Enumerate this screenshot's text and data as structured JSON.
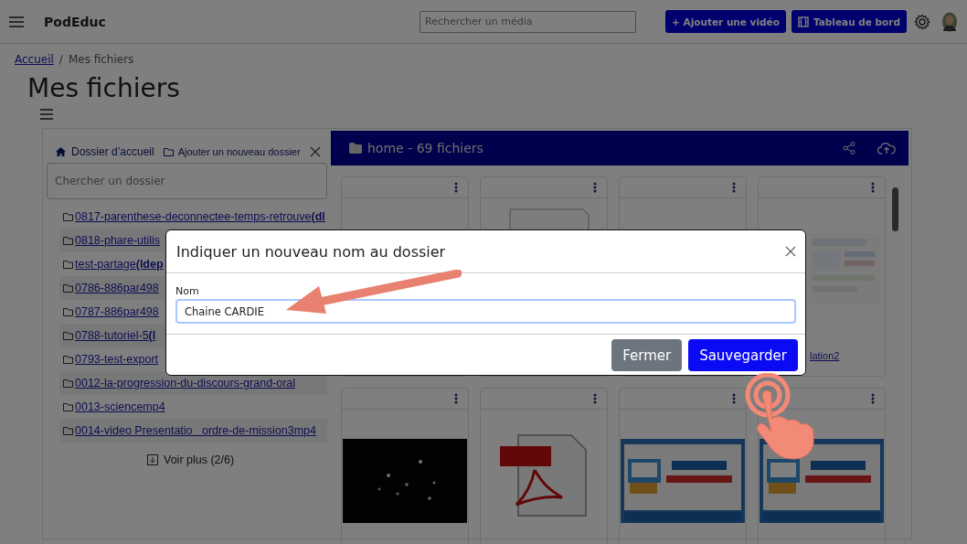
{
  "header": {
    "brand": "PodEduc",
    "search_placeholder": "Rechercher un média",
    "buttons": [
      {
        "label": "+ Ajouter une vidéo",
        "kind": "plain"
      },
      {
        "label": "Tableau de bord",
        "kind": "film"
      }
    ]
  },
  "breadcrumb": [
    {
      "label": "Accueil",
      "link": true
    },
    {
      "separator": "/",
      "label": "Mes fichiers",
      "link": false
    }
  ],
  "title": "Mes fichiers",
  "sidebar": {
    "home_label": "Dossier d’accueil",
    "add_label": "Ajouter un nouveau dossier",
    "search_placeholder": "Chercher un dossier",
    "folders": [
      {
        "name": "0817-parenthese-deconnectee-temps-retrouve**(dl**"
      },
      {
        "name": "0818-phare-utilis"
      },
      {
        "name": "test-partage**(ldep**"
      },
      {
        "name": "0786-886par498"
      },
      {
        "name": "0787-886par498"
      },
      {
        "name": "0788-tutoriel-5**(l**"
      },
      {
        "name": "0793-test-export"
      },
      {
        "name": "0012-la-progression-du-discours-grand-oral"
      },
      {
        "name": "0013-sciencemp4"
      },
      {
        "name": "0014-video Presentatio   ordre-de-mission3mp4"
      }
    ],
    "more_label": "Voir plus (2/6)"
  },
  "files": {
    "heading": "home - 69 fichiers",
    "cards": [
      {
        "kind": "blank"
      },
      {
        "kind": "document"
      },
      {
        "kind": "blank"
      },
      {
        "kind": "picture",
        "caption": "lation2"
      },
      {
        "kind": "picture"
      },
      {
        "kind": "pdf"
      },
      {
        "kind": "picture"
      },
      {
        "kind": "picture"
      }
    ]
  },
  "dialog": {
    "title": "Indiquer un nouveau nom au dossier",
    "field_label": "Nom",
    "value": "Chaine CARDIE",
    "buttons": [
      {
        "label": "Fermer",
        "kind": "secondary"
      },
      {
        "label": "Sauvegarder",
        "kind": "primary"
      }
    ]
  }
}
